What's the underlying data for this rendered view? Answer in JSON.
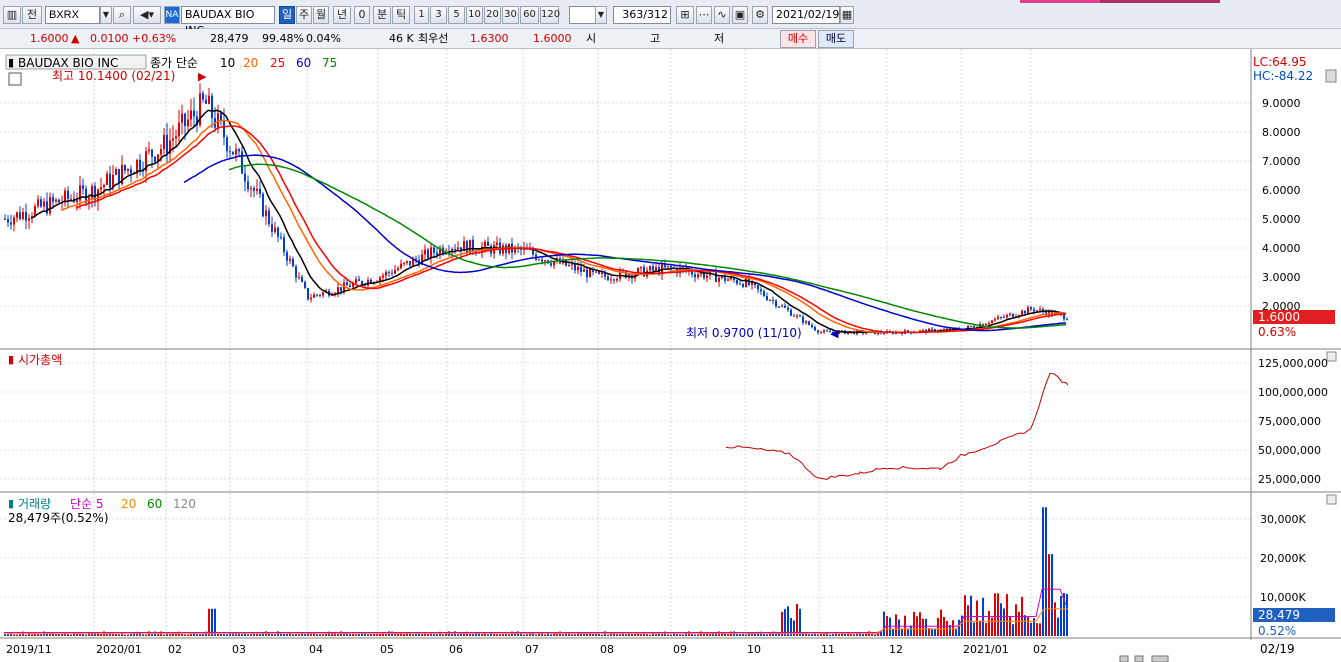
{
  "toolbar": {
    "code": "BXRX",
    "prefix": "전",
    "market_badge": "NA",
    "stock_name": "BAUDAX BIO INC",
    "periods": [
      "일",
      "주",
      "월",
      "년",
      "0"
    ],
    "active_period": "일",
    "minute_label": "분",
    "tick_label": "틱",
    "intervals": [
      "1",
      "3",
      "5",
      "10",
      "20",
      "30",
      "60",
      "120"
    ],
    "count": "363",
    "count_total": "/312",
    "date": "2021/02/19"
  },
  "quote": {
    "price": "1.6000",
    "change": "0.0100",
    "change_pct": "+0.63%",
    "volume": "28,479",
    "vol_ratio": "99.48%",
    "turnover": "0.04%",
    "amount": "46 K",
    "best_label": "최우선",
    "best_ask": "1.6300",
    "best_bid": "1.6000",
    "open_label": "시",
    "high_label": "고",
    "low_label": "저",
    "buy_label": "매수",
    "sell_label": "매도"
  },
  "colors": {
    "up": "#e00000",
    "down": "#0040d0",
    "ma10": "#000000",
    "ma20": "#ff6600",
    "ma25": "#ff0000",
    "ma60": "#0000cc",
    "ma75": "#008800"
  },
  "price_panel": {
    "title": "BAUDAX BIO INC",
    "legend": [
      {
        "label": "종가 단순",
        "color": "#000000"
      },
      {
        "label": "10",
        "color": "#000000"
      },
      {
        "label": "20",
        "color": "#ff6600"
      },
      {
        "label": "25",
        "color": "#ff0000"
      },
      {
        "label": "60",
        "color": "#0000cc"
      },
      {
        "label": "75",
        "color": "#008800"
      }
    ],
    "high_note": "최고 10.1400 (02/21)",
    "low_note": "최저 0.9700 (11/10)",
    "lc": "LC:64.95",
    "hc": "HC:-84.22",
    "price_tag": "1.6000",
    "pct_tag": "0.63%",
    "y_ticks": [
      "9.0000",
      "8.0000",
      "7.0000",
      "6.0000",
      "5.0000",
      "4.0000",
      "3.0000",
      "2.0000"
    ]
  },
  "cap_panel": {
    "title": "시가총액",
    "y_ticks": [
      "125,000,000",
      "100,000,000",
      "75,000,000",
      "50,000,000",
      "25,000,000"
    ]
  },
  "vol_panel": {
    "legend": [
      {
        "label": "거래량",
        "color": "#008080"
      },
      {
        "label": "단순 5",
        "color": "#cc00cc"
      },
      {
        "label": "20",
        "color": "#ff8800"
      },
      {
        "label": "60",
        "color": "#008800"
      },
      {
        "label": "120",
        "color": "#888888"
      }
    ],
    "info": "28,479주(0.52%)",
    "y_ticks": [
      "30,000K",
      "20,000K",
      "10,000K"
    ],
    "vol_tag": "28,479",
    "pct_tag": "0.52%"
  },
  "x_axis": {
    "labels": [
      "2019/11",
      "2020/01",
      "02",
      "03",
      "04",
      "05",
      "06",
      "07",
      "08",
      "09",
      "10",
      "11",
      "12",
      "2021/01",
      "02"
    ],
    "end_label": "02/19"
  },
  "chart_data": [
    {
      "type": "line",
      "title": "BAUDAX BIO INC",
      "ylabel": "",
      "ylim": [
        0.9,
        10.2
      ],
      "x": [
        "2019/11",
        "2019/12",
        "2020/01",
        "2020/02",
        "2020/03",
        "2020/04",
        "2020/05",
        "2020/06",
        "2020/07",
        "2020/08",
        "2020/09",
        "2020/10",
        "2020/11",
        "2020/12",
        "2021/01",
        "2021/02"
      ],
      "series": [
        {
          "name": "종가",
          "values": [
            5.5,
            6.0,
            7.5,
            8.6,
            4.5,
            2.3,
            3.5,
            4.1,
            3.9,
            3.1,
            3.2,
            2.8,
            1.05,
            1.08,
            1.3,
            1.6
          ]
        }
      ],
      "annotations": [
        "최고 10.1400 (02/21)",
        "최저 0.9700 (11/10)"
      ]
    },
    {
      "type": "line",
      "title": "시가총액",
      "ylim": [
        20000000,
        130000000
      ],
      "x": [
        "2020/09",
        "2020/10",
        "2020/11",
        "2020/12",
        "2021/01",
        "2021/02"
      ],
      "series": [
        {
          "name": "시가총액",
          "values": [
            53000000,
            40000000,
            25000000,
            35000000,
            60000000,
            117000000
          ]
        }
      ]
    },
    {
      "type": "bar",
      "title": "거래량",
      "ylim": [
        0,
        35000
      ],
      "x": [
        "2020/02",
        "2020/10",
        "2020/12",
        "2021/01",
        "2021/02"
      ],
      "series": [
        {
          "name": "거래량",
          "values": [
            9000,
            9000,
            10000,
            12000,
            33000
          ]
        }
      ]
    }
  ]
}
